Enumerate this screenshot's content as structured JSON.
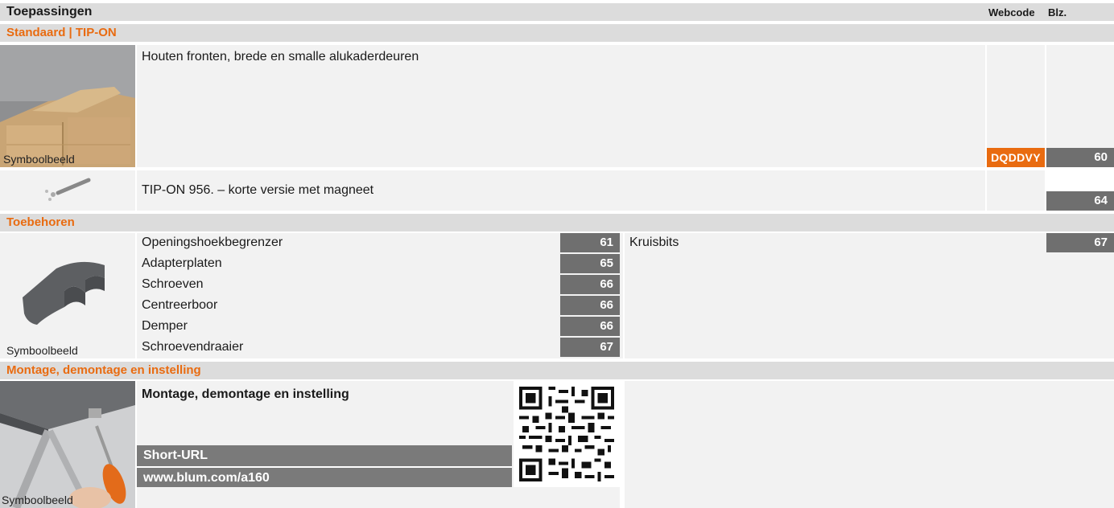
{
  "header": {
    "title": "Toepassingen",
    "col_webcode": "Webcode",
    "col_page": "Blz."
  },
  "sections": {
    "standaard": {
      "title": "Standaard | TIP-ON",
      "row1": {
        "caption": "Symboolbeeld",
        "text": "Houten fronten, brede en smalle alukaderdeuren",
        "webcode": "DQDDVY",
        "page": "60"
      },
      "row2": {
        "text": "TIP-ON 956. – korte versie met magneet",
        "page": "64"
      }
    },
    "toebehoren": {
      "title": "Toebehoren",
      "caption": "Symboolbeeld",
      "left_items": [
        {
          "label": "Openingshoekbegrenzer",
          "page": "61"
        },
        {
          "label": "Adapterplaten",
          "page": "65"
        },
        {
          "label": "Schroeven",
          "page": "66"
        },
        {
          "label": "Centreerboor",
          "page": "66"
        },
        {
          "label": "Demper",
          "page": "66"
        },
        {
          "label": "Schroevendraaier",
          "page": "67"
        }
      ],
      "right_items": [
        {
          "label": "Kruisbits",
          "page": "67"
        }
      ]
    },
    "montage": {
      "title": "Montage, demontage en instelling",
      "caption": "Symboolbeeld",
      "heading": "Montage, demontage en instelling",
      "short_url_label": "Short-URL",
      "short_url": "www.blum.com/a160"
    }
  },
  "colors": {
    "accent": "#e96b10",
    "page_badge": "#6f6f6f",
    "header_bg": "#dcdcdc",
    "panel_bg": "#f2f2f2"
  }
}
